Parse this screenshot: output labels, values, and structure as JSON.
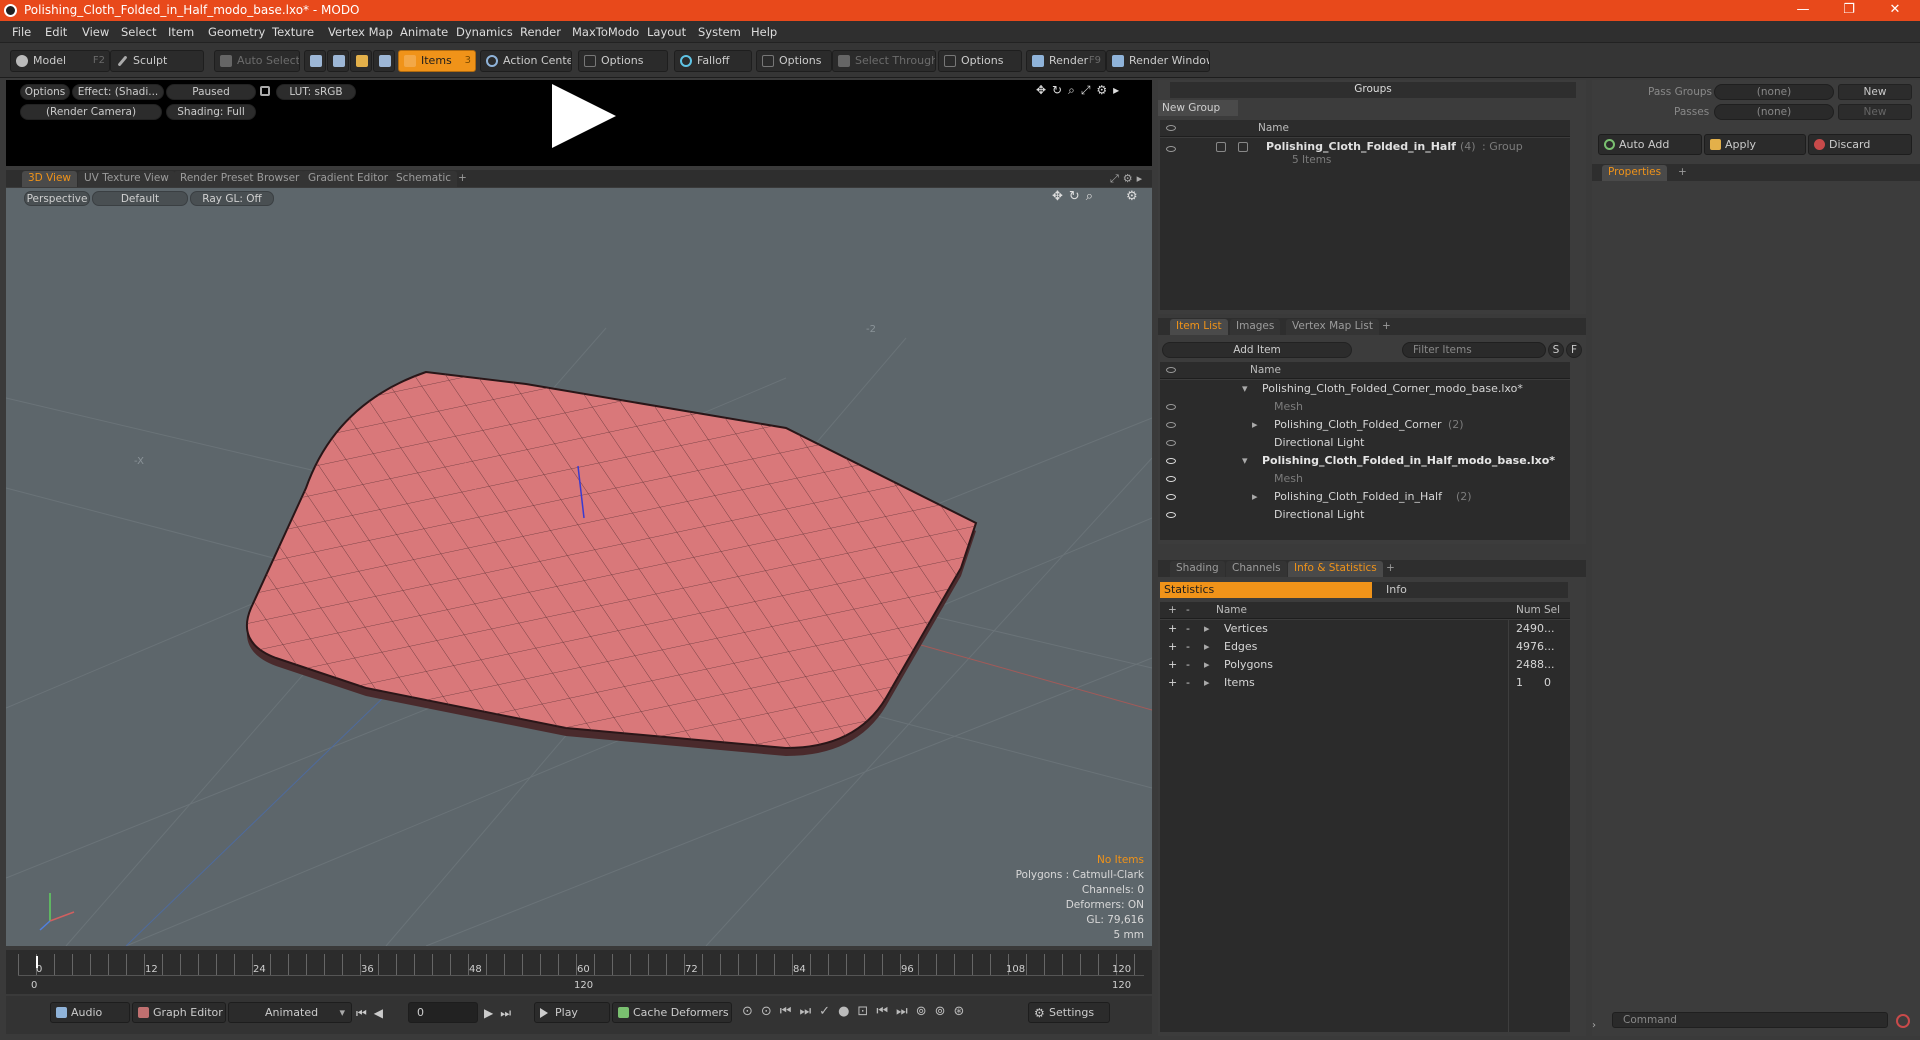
{
  "window": {
    "title": "Polishing_Cloth_Folded_in_Half_modo_base.lxo* - MODO",
    "min": "—",
    "max": "❐",
    "close": "✕"
  },
  "menu": [
    "File",
    "Edit",
    "View",
    "Select",
    "Item",
    "Geometry",
    "Texture",
    "Vertex Map",
    "Animate",
    "Dynamics",
    "Render",
    "MaxToModo",
    "Layout",
    "System",
    "Help"
  ],
  "toolbar": {
    "model": "Model",
    "model_key": "F2",
    "sculpt": "Sculpt",
    "auto_select": "Auto Select",
    "items": "Items",
    "items_key": "3",
    "action_center": "Action Center",
    "options1": "Options",
    "falloff": "Falloff",
    "options2": "Options",
    "select_through": "Select Through",
    "options3": "Options",
    "render": "Render",
    "render_key": "F9",
    "render_window": "Render Window"
  },
  "preview": {
    "options": "Options",
    "effect": "Effect: (Shadi...",
    "paused": "Paused",
    "lut": "LUT: sRGB",
    "camera": "(Render Camera)",
    "shading": "Shading: Full"
  },
  "viewport_tabs": [
    "3D View",
    "UV Texture View",
    "Render Preset Browser",
    "Gradient Editor",
    "Schematic",
    "+"
  ],
  "viewport": {
    "perspective": "Perspective",
    "default": "Default",
    "raygl": "Ray GL: Off",
    "axis_label_z": "-2",
    "axis_label_x": "-X",
    "overlay": {
      "no_items": "No Items",
      "polygons": "Polygons : Catmull-Clark",
      "channels": "Channels: 0",
      "deformers": "Deformers: ON",
      "gl": "GL: 79,616",
      "scale": "5 mm"
    }
  },
  "timeline": {
    "ticks": [
      "0",
      "12",
      "24",
      "36",
      "48",
      "60",
      "72",
      "84",
      "96",
      "108",
      "120"
    ],
    "start": "0",
    "mid": "120",
    "end": "120"
  },
  "bottombar": {
    "audio": "Audio",
    "graph_editor": "Graph Editor",
    "animated": "Animated",
    "frame": "0",
    "play": "Play",
    "cache": "Cache Deformers",
    "settings": "Settings"
  },
  "groups": {
    "title": "Groups",
    "new_group": "New Group",
    "col_name": "Name",
    "item_name": "Polishing_Cloth_Folded_in_Half",
    "item_count": "(4)",
    "item_type": ": Group",
    "item_sub": "5 Items"
  },
  "itemlist": {
    "tabs": [
      "Item List",
      "Images",
      "Vertex Map List",
      "+"
    ],
    "add_item": "Add Item",
    "filter": "Filter Items",
    "s": "S",
    "f": "F",
    "col_name": "Name",
    "rows": [
      {
        "label": "Polishing_Cloth_Folded_Corner_modo_base.lxo*",
        "count": "",
        "style": "scene"
      },
      {
        "label": "Mesh",
        "count": "",
        "style": "mutedchild"
      },
      {
        "label": "Polishing_Cloth_Folded_Corner",
        "count": "(2)",
        "style": "child"
      },
      {
        "label": "Directional Light",
        "count": "",
        "style": "child"
      },
      {
        "label": "Polishing_Cloth_Folded_in_Half_modo_base.lxo*",
        "count": "",
        "style": "scenebold"
      },
      {
        "label": "Mesh",
        "count": "",
        "style": "mutedchild"
      },
      {
        "label": "Polishing_Cloth_Folded_in_Half",
        "count": "(2)",
        "style": "child"
      },
      {
        "label": "Directional Light",
        "count": "",
        "style": "child"
      }
    ]
  },
  "stats": {
    "tabs": [
      "Shading",
      "Channels",
      "Info & Statistics",
      "+"
    ],
    "subtab_stats": "Statistics",
    "subtab_info": "Info",
    "cols": {
      "plus": "+",
      "minus": "-",
      "name": "Name",
      "num": "Num",
      "sel": "Sel"
    },
    "rows": [
      {
        "name": "Vertices",
        "num": "2490",
        "sel": "..."
      },
      {
        "name": "Edges",
        "num": "4976",
        "sel": "..."
      },
      {
        "name": "Polygons",
        "num": "2488",
        "sel": "..."
      },
      {
        "name": "Items",
        "num": "1",
        "sel": "0"
      }
    ]
  },
  "right": {
    "pass_groups": "Pass Groups",
    "passes": "Passes",
    "none1": "(none)",
    "none2": "(none)",
    "new1": "New",
    "new2": "New",
    "auto_add": "Auto Add",
    "apply": "Apply",
    "discard": "Discard",
    "properties": "Properties",
    "plus": "+",
    "command": "Command"
  },
  "colors": {
    "accent": "#f09319",
    "title_bar": "#e8491b",
    "mesh_fill": "#d9787a",
    "viewport_bg": "#5d666b"
  }
}
